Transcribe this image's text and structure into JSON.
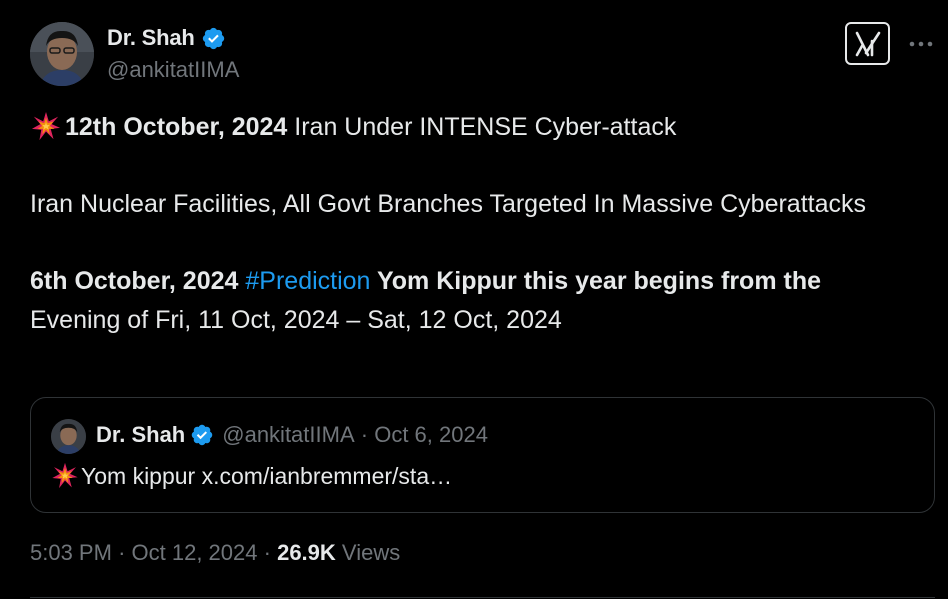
{
  "author": {
    "display_name": "Dr. Shah",
    "handle": "@ankitatIIMA",
    "verified": true
  },
  "header_actions": {
    "grok_icon": "grok-icon",
    "more_icon": "more-horizontal-icon"
  },
  "tweet": {
    "line1_emoji": "collision-emoji",
    "line1_date": "12th October, 2024",
    "line1_text": " Iran Under INTENSE Cyber-attack",
    "para2": "Iran Nuclear Facilities, All Govt Branches Targeted In Massive Cyberattacks",
    "para3_date": "6th October, 2024",
    "para3_hashtag": "#Prediction",
    "para3_bold": " Yom Kippur this year begins from the",
    "para3_rest": "Evening of Fri, 11 Oct, 2024 – Sat, 12 Oct, 2024"
  },
  "quote": {
    "display_name": "Dr. Shah",
    "handle": "@ankitatIIMA",
    "separator": "·",
    "date": "Oct 6, 2024",
    "text": "Yom kippur x.com/ianbremmer/sta…"
  },
  "footer": {
    "time": "5:03 PM",
    "separator": "·",
    "date": "Oct 12, 2024",
    "views_count": "26.9K",
    "views_label": "Views"
  },
  "colors": {
    "background": "#000000",
    "text": "#e7e9ea",
    "muted": "#71767b",
    "accent": "#1d9bf0",
    "border": "#2f3336"
  }
}
